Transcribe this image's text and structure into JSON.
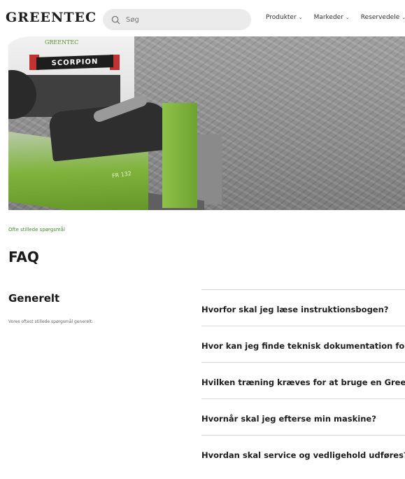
{
  "header": {
    "logo_text": "GREENTEC",
    "search_placeholder": "Søg",
    "nav": [
      {
        "label": "Produkter",
        "chevron": "⌄"
      },
      {
        "label": "Markeder",
        "chevron": "⌄"
      },
      {
        "label": "Reservedele",
        "chevron": "⌄"
      }
    ],
    "icons": {
      "search": "search-icon"
    }
  },
  "hero": {
    "truck_brand": "GREENTEC",
    "truck_plate": "SCORPION",
    "mower_label": "FR 132"
  },
  "faq": {
    "eyebrow": "Ofte stillede spørgsmål",
    "title": "FAQ",
    "category_title": "Generelt",
    "category_description": "Vores oftest stillede spørgsmål generelt:",
    "questions": [
      "Hvorfor skal jeg læse instruktionsbogen?",
      "Hvor kan jeg finde teknisk dokumentation for min maskine?",
      "Hvilken træning kræves for at bruge en Greentec maskine?",
      "Hvornår skal jeg efterse min maskine?",
      "Hvordan skal service og vedligehold udføres?"
    ]
  },
  "colors": {
    "accent": "#3f8f2c",
    "brand_green": "#6fae2a"
  }
}
